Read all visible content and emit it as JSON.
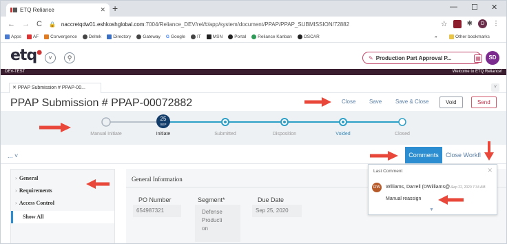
{
  "browser": {
    "tab_title": "ETQ Reliance",
    "url_host": "naccretqdw01.eshkoshglobal.com",
    "url_path": ":7004/Reliance_DEV/rel/#/app/system/document/PPAP/PPAP_SUBMISSION/72882",
    "profile_initial": "D",
    "bookmarks": [
      "Apps",
      "AF",
      "Convergence",
      "Deltek",
      "Directory",
      "Gateway",
      "Google",
      "IT",
      "MSN",
      "Portal",
      "Reliance Kanban",
      "OSCAR",
      "Other bookmarks"
    ],
    "bookmarks_more": "»"
  },
  "app": {
    "logo": "etq",
    "doc_pill": "Production Part Approval P...",
    "user_initials": "SD",
    "env": "DEV-TEST",
    "welcome": "Welcome to ETQ Reliance!"
  },
  "doc_tab": {
    "label": "PPAP Submission # PPAP-00..."
  },
  "title": "PPAP Submission # PPAP-00072882",
  "actions": {
    "close": "Close",
    "save": "Save",
    "save_close": "Save & Close",
    "void": "Void",
    "send": "Send"
  },
  "workflow": {
    "date_day": "25",
    "date_month": "SEP",
    "steps": [
      "Manual Initiate",
      "Initiate",
      "Submitted",
      "Disposition",
      "Voided",
      "Closed"
    ]
  },
  "toolbar": {
    "expander": "... ˅",
    "comments": "Comments",
    "close_workflow": "Close Workfl"
  },
  "nav": {
    "items": [
      "General",
      "Requirements",
      "Access Control"
    ],
    "show_all": "Show All"
  },
  "general": {
    "header": "General Information",
    "po_label": "PO Number",
    "po_value": "654987321",
    "segment_label": "Segment*",
    "segment_lines": [
      "Defense",
      "Producti",
      "on"
    ],
    "due_label": "Due Date",
    "due_value": "Sep 25, 2020"
  },
  "comment_popup": {
    "title": "Last Comment",
    "avatar": "DW",
    "author": "Williams, Darrell (DWilliams@...",
    "date": "Sep 22, 2020 7:34 AM",
    "text": "Manual reassign",
    "more": "▼"
  },
  "colors": {
    "accent_blue": "#2c8ed0",
    "arrow_red": "#e8473a",
    "brand_dark": "#3b1d30",
    "send_red": "#c1354e"
  }
}
